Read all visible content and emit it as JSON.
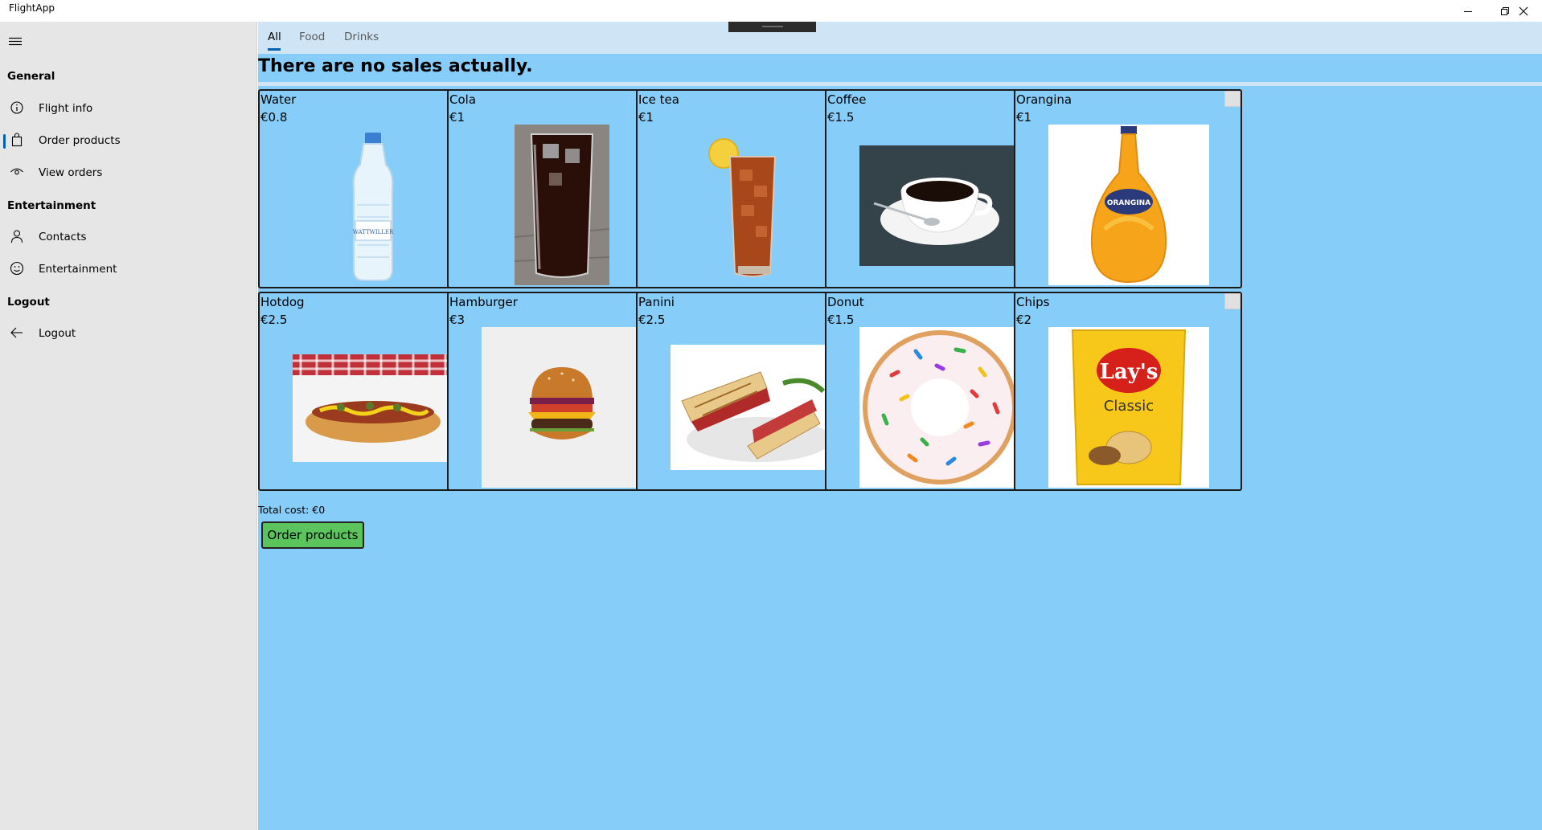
{
  "window": {
    "title": "FlightApp"
  },
  "sidebar": {
    "sections": [
      {
        "header": "General",
        "items": [
          {
            "label": "Flight info",
            "icon": "info-icon",
            "selected": false
          },
          {
            "label": "Order products",
            "icon": "shopping-bag-icon",
            "selected": true
          },
          {
            "label": "View orders",
            "icon": "eye-icon",
            "selected": false
          }
        ]
      },
      {
        "header": "Entertainment",
        "items": [
          {
            "label": "Contacts",
            "icon": "person-icon",
            "selected": false
          },
          {
            "label": "Entertainment",
            "icon": "smiley-icon",
            "selected": false
          }
        ]
      },
      {
        "header": "Logout",
        "items": [
          {
            "label": "Logout",
            "icon": "back-arrow-icon",
            "selected": false
          }
        ]
      }
    ]
  },
  "tabs": [
    {
      "label": "All",
      "active": true
    },
    {
      "label": "Food",
      "active": false
    },
    {
      "label": "Drinks",
      "active": false
    }
  ],
  "main": {
    "heading": "There are no sales actually.",
    "total": "Total cost: €0",
    "order_button": "Order products"
  },
  "products": [
    {
      "name": "Water",
      "price": "€0.8",
      "image": "water-bottle-image",
      "checked": false
    },
    {
      "name": "Cola",
      "price": "€1",
      "image": "cola-glass-image",
      "checked": false
    },
    {
      "name": "Ice tea",
      "price": "€1",
      "image": "ice-tea-glass-image",
      "checked": false
    },
    {
      "name": "Coffee",
      "price": "€1.5",
      "image": "coffee-cup-image",
      "checked": false
    },
    {
      "name": "Orangina",
      "price": "€1",
      "image": "orangina-bottle-image",
      "checked": false
    },
    {
      "name": "Hotdog",
      "price": "€2.5",
      "image": "hotdog-image",
      "checked": false
    },
    {
      "name": "Hamburger",
      "price": "€3",
      "image": "hamburger-image",
      "checked": false
    },
    {
      "name": "Panini",
      "price": "€2.5",
      "image": "panini-image",
      "checked": false
    },
    {
      "name": "Donut",
      "price": "€1.5",
      "image": "donut-image",
      "checked": false
    },
    {
      "name": "Chips",
      "price": "€2",
      "image": "chips-bag-image",
      "checked": false
    }
  ],
  "image_text": {
    "water": "WATTWILLER",
    "orangina": "ORANGINA",
    "chips_brand": "Lay's",
    "chips_variant": "Classic"
  },
  "colors": {
    "content_background": "#87cdfa",
    "tab_bar": "#cfe4f4",
    "sidebar": "#e6e6e6",
    "accent": "#0063b1",
    "order_button": "#5cc45c"
  }
}
